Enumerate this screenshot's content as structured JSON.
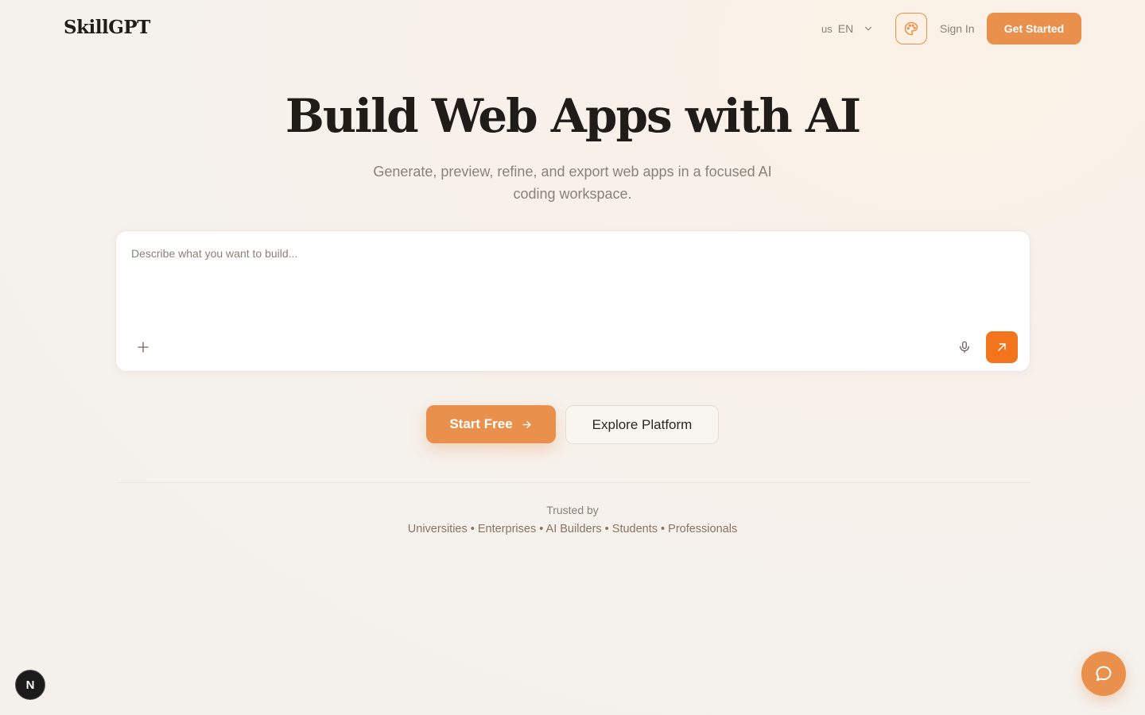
{
  "header": {
    "logo": "SkillGPT",
    "language": {
      "flag": "us",
      "code": "EN"
    },
    "sign_in": "Sign In",
    "get_started": "Get Started"
  },
  "hero": {
    "title": "Build Web Apps with AI",
    "subtitle": "Generate, preview, refine, and export web apps in a focused AI coding workspace."
  },
  "prompt": {
    "placeholder": "Describe what you want to build..."
  },
  "cta": {
    "start_free": "Start Free",
    "explore": "Explore Platform"
  },
  "trusted": {
    "label": "Trusted by",
    "list": "Universities • Enterprises • AI Builders • Students • Professionals"
  },
  "badge": {
    "letter": "N"
  },
  "colors": {
    "accent": "#e8904c",
    "send": "#f2741c",
    "heading": "#1f1c19",
    "muted": "#8a8178"
  },
  "icons": {
    "theme": "palette-icon",
    "attach": "plus-icon",
    "mic": "microphone-icon",
    "send": "arrow-up-right-icon",
    "chat": "chat-bubble-icon"
  }
}
